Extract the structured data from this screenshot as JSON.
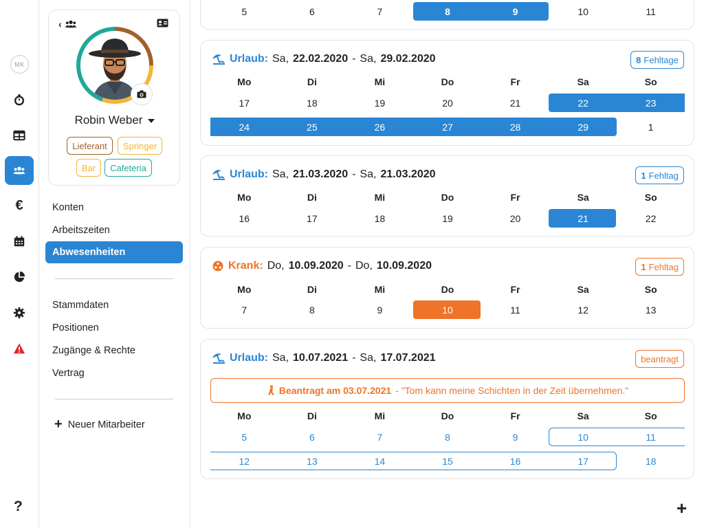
{
  "rail": {
    "user_initials": "MK"
  },
  "profile": {
    "name": "Robin Weber",
    "tags": [
      {
        "label": "Lieferant",
        "color": "#a0612b"
      },
      {
        "label": "Springer",
        "color": "#f2b535"
      },
      {
        "label": "Bar",
        "color": "#f2b535"
      },
      {
        "label": "Cafeteria",
        "color": "#20a898"
      }
    ]
  },
  "nav": {
    "group1": [
      "Konten",
      "Arbeitszeiten",
      "Abwesenheiten"
    ],
    "active": "Abwesenheiten",
    "group2": [
      "Stammdaten",
      "Positionen",
      "Zugänge & Rechte",
      "Vertrag"
    ],
    "new_employee": "Neuer Mitarbeiter"
  },
  "colors": {
    "blue": "#2a86d4",
    "orange": "#ef7328"
  },
  "weekdays": [
    "Mo",
    "Di",
    "Mi",
    "Do",
    "Fr",
    "Sa",
    "So"
  ],
  "top_partial": {
    "days": [
      "5",
      "6",
      "7",
      "8",
      "9",
      "10",
      "11"
    ]
  },
  "absences": [
    {
      "type": "Urlaub:",
      "from_day": "Sa,",
      "from_date": "22.02.2020",
      "to_day": "Sa,",
      "to_date": "29.02.2020",
      "badge_num": "8",
      "badge_text": "Fehltage",
      "weeks": [
        [
          "17",
          "18",
          "19",
          "20",
          "21",
          "22",
          "23"
        ],
        [
          "24",
          "25",
          "26",
          "27",
          "28",
          "29",
          "1"
        ]
      ]
    },
    {
      "type": "Urlaub:",
      "from_day": "Sa,",
      "from_date": "21.03.2020",
      "to_day": "Sa,",
      "to_date": "21.03.2020",
      "badge_num": "1",
      "badge_text": "Fehltag",
      "weeks": [
        [
          "16",
          "17",
          "18",
          "19",
          "20",
          "21",
          "22"
        ]
      ]
    },
    {
      "type": "Krank:",
      "from_day": "Do,",
      "from_date": "10.09.2020",
      "to_day": "Do,",
      "to_date": "10.09.2020",
      "badge_num": "1",
      "badge_text": "Fehltag",
      "weeks": [
        [
          "7",
          "8",
          "9",
          "10",
          "11",
          "12",
          "13"
        ]
      ]
    },
    {
      "type": "Urlaub:",
      "from_day": "Sa,",
      "from_date": "10.07.2021",
      "to_day": "Sa,",
      "to_date": "17.07.2021",
      "badge_text": "beantragt",
      "request_label": "Beantragt am 03.07.2021",
      "request_comment": " - \"Tom kann meine Schichten in der Zeit übernehmen.\"",
      "weeks": [
        [
          "5",
          "6",
          "7",
          "8",
          "9",
          "10",
          "11"
        ],
        [
          "12",
          "13",
          "14",
          "15",
          "16",
          "17",
          "18"
        ]
      ]
    }
  ]
}
